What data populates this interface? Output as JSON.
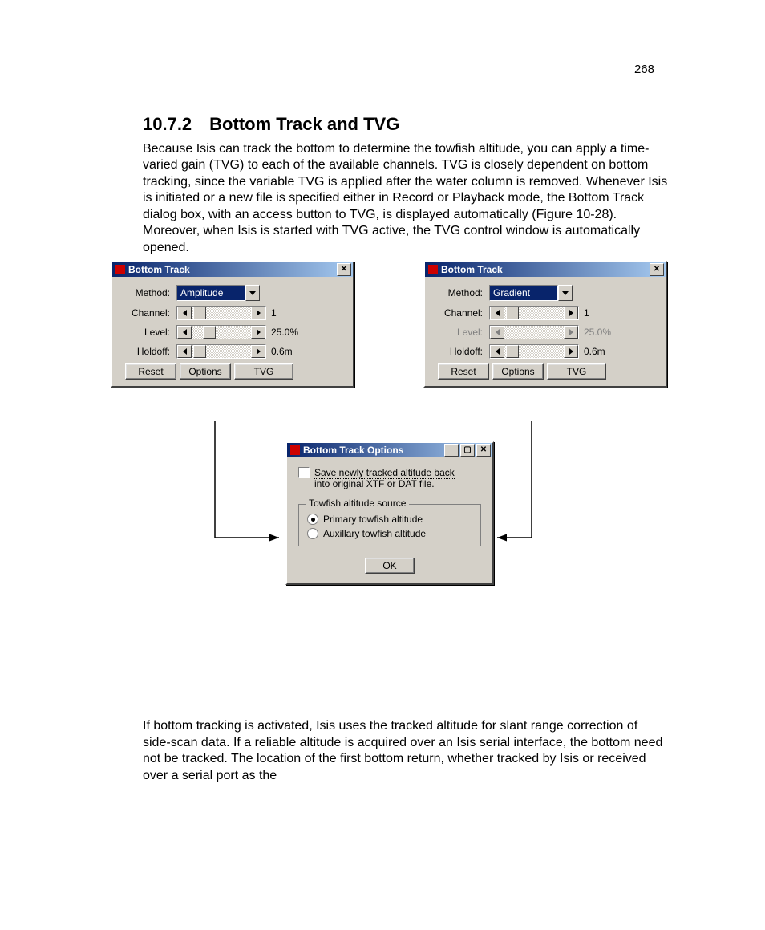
{
  "page_number": "268",
  "heading_number": "10.7.2",
  "heading_title": "Bottom Track and TVG",
  "para1": "Because Isis can track the bottom to determine the towfish altitude, you can apply a time-varied gain (TVG) to each of the available channels. TVG is closely dependent on bottom tracking, since the variable TVG is applied after the water column is removed. Whenever Isis is initiated or a new file is specified either in Record or Playback mode, the Bottom Track dialog box, with an access button to TVG, is displayed automatically (Figure 10-28). Moreover, when Isis is started with TVG active, the TVG control window is automatically opened.",
  "para2": "If bottom tracking is activated, Isis uses the tracked altitude for slant range correction of side-scan data. If a reliable altitude is acquired over an Isis serial interface, the bottom need not be tracked. The location of the first bottom return, whether tracked by Isis or received over a serial port as the",
  "dlg_left": {
    "title": "Bottom Track",
    "method_label": "Method:",
    "method_value": "Amplitude",
    "channel_label": "Channel:",
    "channel_value": "1",
    "level_label": "Level:",
    "level_value": "25.0%",
    "holdoff_label": "Holdoff:",
    "holdoff_value": "0.6m",
    "btn_reset": "Reset",
    "btn_options": "Options",
    "btn_tvg": "TVG"
  },
  "dlg_right": {
    "title": "Bottom Track",
    "method_label": "Method:",
    "method_value": "Gradient",
    "channel_label": "Channel:",
    "channel_value": "1",
    "level_label": "Level:",
    "level_value": "25.0%",
    "holdoff_label": "Holdoff:",
    "holdoff_value": "0.6m",
    "btn_reset": "Reset",
    "btn_options": "Options",
    "btn_tvg": "TVG"
  },
  "dlg_opts": {
    "title": "Bottom Track Options",
    "chk_label_line1": "Save newly tracked altitude back",
    "chk_label_line2": "into original XTF or DAT file.",
    "group_title": "Towfish altitude source",
    "radio1": "Primary towfish altitude",
    "radio2": "Auxillary towfish altitude",
    "btn_ok": "OK"
  }
}
